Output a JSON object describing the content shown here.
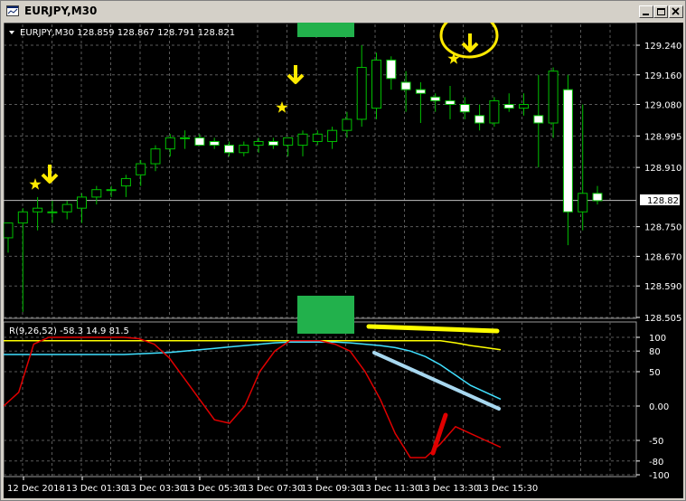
{
  "window": {
    "title": "EURJPY,M30"
  },
  "header_text": "EURJPY,M30  128.859 128.867 128.791 128.821",
  "indicator_text": "R(9,26,52) -58.3 14.9 81.5",
  "current_price": "128.821",
  "colors": {
    "background": "#000000",
    "candle_up": "#000000",
    "candle_down": "#ffffff",
    "wick": "#00c000",
    "grid": "#5a5a5a",
    "red_line": "#e00000",
    "yellow_line": "#ffff00",
    "cyan_line": "#40e0ff",
    "green_box": "#22b14c",
    "arrow": "#ffea00"
  },
  "price_axis": {
    "labels": [
      "129.240",
      "129.160",
      "129.080",
      "128.995",
      "128.910",
      "128.750",
      "128.670",
      "128.590",
      "128.505"
    ]
  },
  "indicator_axis": {
    "labels": [
      "100",
      "80",
      "50",
      "0.00",
      "-50",
      "-80",
      "-100"
    ]
  },
  "time_axis": {
    "labels": [
      "12 Dec 2018",
      "13 Dec 01:30",
      "13 Dec 03:30",
      "13 Dec 05:30",
      "13 Dec 07:30",
      "13 Dec 09:30",
      "13 Dec 11:30",
      "13 Dec 13:30",
      "13 Dec 15:30"
    ]
  },
  "chart_data": {
    "type": "candlestick",
    "symbol": "EURJPY",
    "timeframe": "M30",
    "candles": [
      {
        "o": 128.72,
        "h": 128.76,
        "l": 128.68,
        "c": 128.76
      },
      {
        "o": 128.76,
        "h": 128.8,
        "l": 128.52,
        "c": 128.79
      },
      {
        "o": 128.79,
        "h": 128.83,
        "l": 128.74,
        "c": 128.8
      },
      {
        "o": 128.79,
        "h": 128.82,
        "l": 128.76,
        "c": 128.79
      },
      {
        "o": 128.79,
        "h": 128.82,
        "l": 128.77,
        "c": 128.81
      },
      {
        "o": 128.8,
        "h": 128.84,
        "l": 128.76,
        "c": 128.83
      },
      {
        "o": 128.83,
        "h": 128.86,
        "l": 128.81,
        "c": 128.85
      },
      {
        "o": 128.85,
        "h": 128.86,
        "l": 128.83,
        "c": 128.85
      },
      {
        "o": 128.86,
        "h": 128.89,
        "l": 128.83,
        "c": 128.88
      },
      {
        "o": 128.89,
        "h": 128.93,
        "l": 128.86,
        "c": 128.92
      },
      {
        "o": 128.92,
        "h": 128.97,
        "l": 128.9,
        "c": 128.96
      },
      {
        "o": 128.96,
        "h": 129.0,
        "l": 128.94,
        "c": 128.99
      },
      {
        "o": 128.99,
        "h": 129.01,
        "l": 128.96,
        "c": 128.99
      },
      {
        "o": 128.99,
        "h": 129.0,
        "l": 128.97,
        "c": 128.97
      },
      {
        "o": 128.98,
        "h": 128.99,
        "l": 128.96,
        "c": 128.97
      },
      {
        "o": 128.97,
        "h": 128.98,
        "l": 128.94,
        "c": 128.95
      },
      {
        "o": 128.95,
        "h": 128.98,
        "l": 128.94,
        "c": 128.97
      },
      {
        "o": 128.97,
        "h": 128.99,
        "l": 128.95,
        "c": 128.98
      },
      {
        "o": 128.98,
        "h": 128.99,
        "l": 128.96,
        "c": 128.97
      },
      {
        "o": 128.97,
        "h": 128.99,
        "l": 128.94,
        "c": 128.99
      },
      {
        "o": 128.97,
        "h": 129.01,
        "l": 128.94,
        "c": 129.0
      },
      {
        "o": 128.98,
        "h": 129.01,
        "l": 128.97,
        "c": 129.0
      },
      {
        "o": 128.98,
        "h": 129.02,
        "l": 128.96,
        "c": 129.01
      },
      {
        "o": 129.01,
        "h": 129.06,
        "l": 128.99,
        "c": 129.04
      },
      {
        "o": 129.04,
        "h": 129.24,
        "l": 129.02,
        "c": 129.18
      },
      {
        "o": 129.07,
        "h": 129.22,
        "l": 129.04,
        "c": 129.2
      },
      {
        "o": 129.2,
        "h": 129.21,
        "l": 129.12,
        "c": 129.15
      },
      {
        "o": 129.14,
        "h": 129.17,
        "l": 129.06,
        "c": 129.12
      },
      {
        "o": 129.12,
        "h": 129.14,
        "l": 129.03,
        "c": 129.11
      },
      {
        "o": 129.1,
        "h": 129.11,
        "l": 129.06,
        "c": 129.09
      },
      {
        "o": 129.09,
        "h": 129.13,
        "l": 129.04,
        "c": 129.08
      },
      {
        "o": 129.08,
        "h": 129.1,
        "l": 129.04,
        "c": 129.06
      },
      {
        "o": 129.05,
        "h": 129.08,
        "l": 129.01,
        "c": 129.03
      },
      {
        "o": 129.03,
        "h": 129.1,
        "l": 129.02,
        "c": 129.09
      },
      {
        "o": 129.08,
        "h": 129.11,
        "l": 129.06,
        "c": 129.07
      },
      {
        "o": 129.07,
        "h": 129.11,
        "l": 129.05,
        "c": 129.08
      },
      {
        "o": 129.05,
        "h": 129.16,
        "l": 128.91,
        "c": 129.03
      },
      {
        "o": 129.03,
        "h": 129.18,
        "l": 128.99,
        "c": 129.17
      },
      {
        "o": 129.12,
        "h": 129.16,
        "l": 128.7,
        "c": 128.79
      },
      {
        "o": 128.79,
        "h": 129.08,
        "l": 128.74,
        "c": 128.84
      },
      {
        "o": 128.84,
        "h": 128.86,
        "l": 128.81,
        "c": 128.82
      }
    ],
    "indicator": {
      "name": "R(9,26,52)",
      "red": [
        0,
        20,
        90,
        100,
        100,
        100,
        100,
        100,
        100,
        98,
        90,
        70,
        40,
        10,
        -20,
        -25,
        0,
        50,
        80,
        95,
        95,
        95,
        90,
        80,
        50,
        10,
        -40,
        -75,
        -75,
        -55,
        -30,
        -40,
        -50,
        -60
      ],
      "yellow": [
        95,
        95,
        95,
        95,
        95,
        95,
        95,
        95,
        95,
        95,
        95,
        95,
        95,
        95,
        95,
        95,
        95,
        95,
        95,
        95,
        95,
        95,
        95,
        95,
        95,
        95,
        95,
        95,
        95,
        95,
        92,
        88,
        85,
        82
      ],
      "cyan": [
        75,
        75,
        75,
        75,
        75,
        75,
        75,
        75,
        75,
        76,
        77,
        78,
        80,
        82,
        84,
        86,
        88,
        90,
        92,
        93,
        93,
        93,
        93,
        92,
        90,
        88,
        85,
        80,
        72,
        60,
        45,
        30,
        20,
        10
      ]
    }
  }
}
